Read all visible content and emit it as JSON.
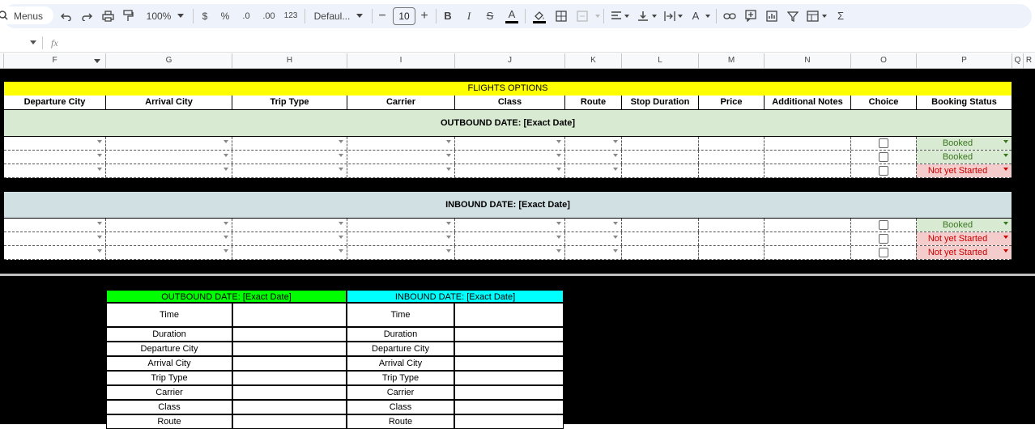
{
  "toolbar": {
    "menus": "Menus",
    "zoom": "100%",
    "currency": "$",
    "percent": "%",
    "dec_less": ".0",
    "dec_more": ".00",
    "number_format": "123",
    "font": "Defaul...",
    "font_size": "10",
    "minus": "−",
    "plus": "+",
    "bold": "B",
    "italic": "I",
    "strike": "S",
    "text_color": "A",
    "rotate": "A",
    "sigma": "Σ"
  },
  "formula_bar": {
    "fx": "fx",
    "cell_ref": ""
  },
  "columns": [
    "F",
    "G",
    "H",
    "I",
    "J",
    "K",
    "L",
    "M",
    "N",
    "O",
    "P",
    "Q",
    "R"
  ],
  "sheet": {
    "title": "FLIGHTS OPTIONS",
    "headers": [
      "Departure City",
      "Arrival City",
      "Trip Type",
      "Carrier",
      "Class",
      "Route",
      "Stop Duration",
      "Price",
      "Additional Notes",
      "Choice",
      "Booking Status"
    ],
    "outbound_label": "OUTBOUND DATE: [Exact Date]",
    "inbound_label": "INBOUND DATE: [Exact Date]",
    "outbound_rows": [
      {
        "status": "Booked"
      },
      {
        "status": "Booked"
      },
      {
        "status": "Not yet Started"
      }
    ],
    "inbound_rows": [
      {
        "status": "Booked"
      },
      {
        "status": "Not yet Started"
      },
      {
        "status": "Not yet Started"
      }
    ]
  },
  "lower": {
    "outbound_title": "OUTBOUND DATE: [Exact Date]",
    "inbound_title": "INBOUND DATE: [Exact Date]",
    "fields": [
      "Time",
      "Duration",
      "Departure City",
      "Arrival City",
      "Trip Type",
      "Carrier",
      "Class",
      "Route"
    ]
  },
  "colors": {
    "title_band": "#ffff00",
    "outbound_band": "#d9ead3",
    "inbound_band": "#d0e0e3",
    "lower_outbound": "#00ff00",
    "lower_inbound": "#00ffff"
  }
}
